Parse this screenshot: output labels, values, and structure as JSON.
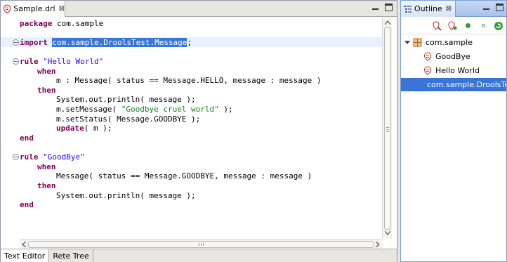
{
  "editor": {
    "tab_title": "Sample.drl",
    "tab_close": "⊠",
    "code": {
      "package_kw": "package",
      "package_name": " com.sample",
      "import_kw": "import",
      "import_target": "com.sample.DroolsTest.Message",
      "import_semicolon": ";",
      "rule1_kw": "rule",
      "rule1_name": " \"Hello World\"",
      "when": "when",
      "rule1_cond": "m : Message( status == Message.HELLO, message : message )",
      "then": "then",
      "rule1_act1": "System.out.println( message );",
      "rule1_act2_pre": "m.setMessage( ",
      "rule1_act2_str": "\"Goodbye cruel world\"",
      "rule1_act2_post": " );",
      "rule1_act3": "m.setStatus( Message.GOODBYE );",
      "update_kw": "update",
      "rule1_act4": "( m );",
      "end": "end",
      "rule2_kw": "rule",
      "rule2_name": " \"GoodBye\"",
      "rule2_cond": "Message( status == Message.GOODBYE, message : message )",
      "rule2_act1": "System.out.println( message );"
    },
    "bottom_tabs": [
      "Text Editor",
      "Rete Tree"
    ]
  },
  "outline": {
    "tab_title": "Outline",
    "tab_close": "⊠",
    "tree": {
      "package": "com.sample",
      "rules": [
        "GoodBye",
        "Hello World"
      ],
      "import": "com.sample.DroolsTest.Message"
    }
  },
  "colors": {
    "keyword": "#7f0055",
    "string": "#2a00ff",
    "selection": "#3875d7",
    "current_line": "#e8f2fe"
  },
  "icons": [
    "drools-file-icon",
    "close-icon",
    "minimize-icon",
    "maximize-icon",
    "package-icon",
    "rule-icon",
    "import-icon",
    "sort-icon",
    "filter-icon",
    "green-dot-icon",
    "refresh-icon"
  ]
}
